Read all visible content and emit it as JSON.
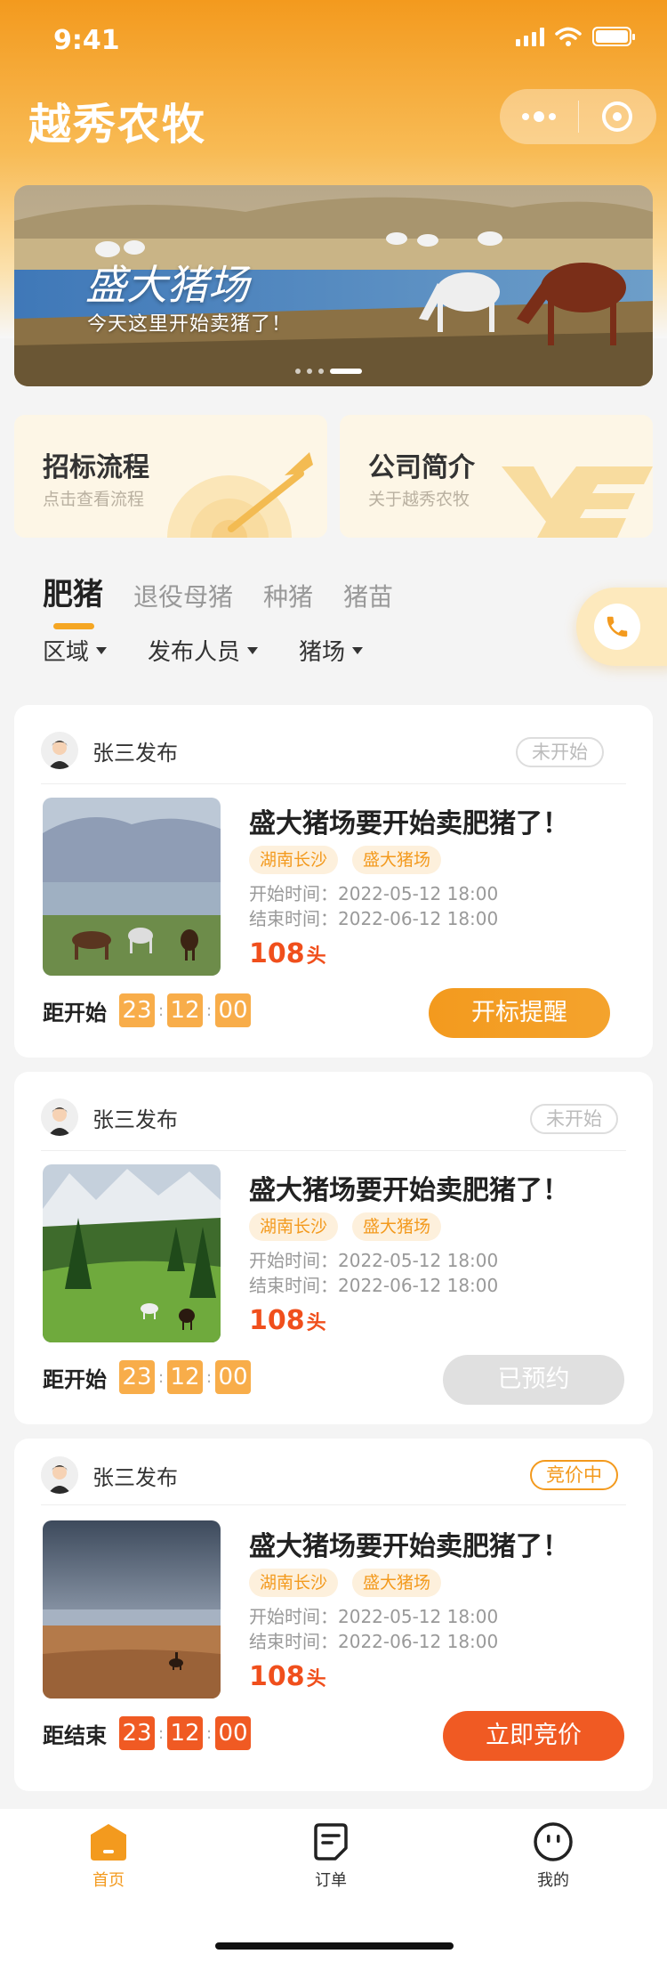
{
  "status_bar": {
    "time": "9:41"
  },
  "header": {
    "title": "越秀农牧"
  },
  "banner": {
    "title": "盛大猪场",
    "subtitle": "今天这里开始卖猪了！"
  },
  "entries": [
    {
      "title": "招标流程",
      "subtitle": "点击查看流程"
    },
    {
      "title": "公司简介",
      "subtitle": "关于越秀农牧"
    }
  ],
  "tabs": [
    "肥猪",
    "退役母猪",
    "种猪",
    "猪苗"
  ],
  "filters": [
    "区域",
    "发布人员",
    "猪场"
  ],
  "listings": [
    {
      "publisher": "张三发布",
      "status": "未开始",
      "title": "盛大猪场要开始卖肥猪了！",
      "tags": [
        "湖南长沙",
        "盛大猪场"
      ],
      "start_label": "开始时间：",
      "start_time": "2022-05-12   18:00",
      "end_label": "结束时间：",
      "end_time": "2022-06-12   18:00",
      "count": "108",
      "unit": "头",
      "countdown_label": "距开始",
      "countdown": [
        "23",
        "12",
        "00"
      ],
      "button": "开标提醒"
    },
    {
      "publisher": "张三发布",
      "status": "未开始",
      "title": "盛大猪场要开始卖肥猪了！",
      "tags": [
        "湖南长沙",
        "盛大猪场"
      ],
      "start_label": "开始时间：",
      "start_time": "2022-05-12   18:00",
      "end_label": "结束时间：",
      "end_time": "2022-06-12   18:00",
      "count": "108",
      "unit": "头",
      "countdown_label": "距开始",
      "countdown": [
        "23",
        "12",
        "00"
      ],
      "button": "已预约"
    },
    {
      "publisher": "张三发布",
      "status": "竞价中",
      "title": "盛大猪场要开始卖肥猪了！",
      "tags": [
        "湖南长沙",
        "盛大猪场"
      ],
      "start_label": "开始时间：",
      "start_time": "2022-05-12   18:00",
      "end_label": "结束时间：",
      "end_time": "2022-06-12   18:00",
      "count": "108",
      "unit": "头",
      "countdown_label": "距结束",
      "countdown": [
        "23",
        "12",
        "00"
      ],
      "button": "立即竞价"
    }
  ],
  "tabbar": [
    {
      "label": "首页",
      "icon": "home-icon"
    },
    {
      "label": "订单",
      "icon": "order-icon"
    },
    {
      "label": "我的",
      "icon": "profile-icon"
    }
  ],
  "colors": {
    "brand": "#f39a1e",
    "accent_red": "#f05a23",
    "muted": "#999999"
  }
}
